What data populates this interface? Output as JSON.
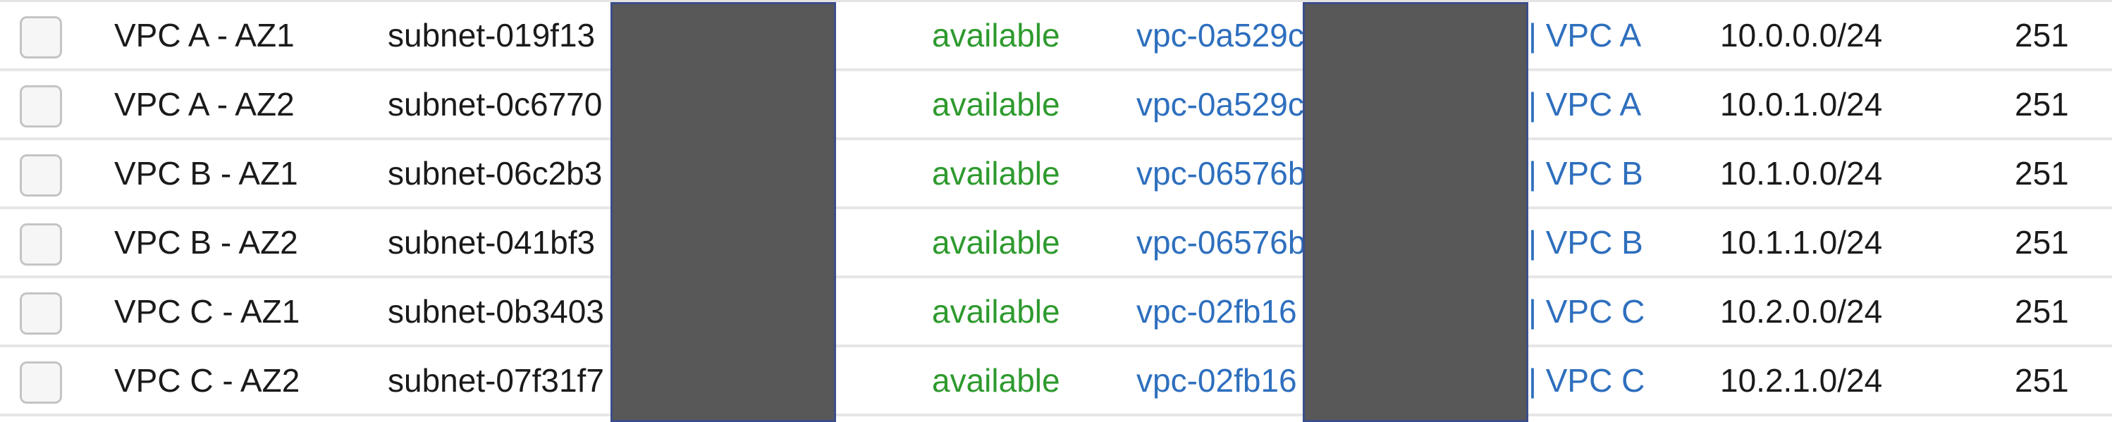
{
  "subnets_table": {
    "rows": [
      {
        "name": "VPC A - AZ1",
        "subnet_id": "subnet-019f13",
        "state": "available",
        "vpc_id": "vpc-0a529c",
        "vpc_name": "| VPC A",
        "cidr": "10.0.0.0/24",
        "available_ips": "251"
      },
      {
        "name": "VPC A - AZ2",
        "subnet_id": "subnet-0c6770",
        "state": "available",
        "vpc_id": "vpc-0a529c",
        "vpc_name": "| VPC A",
        "cidr": "10.0.1.0/24",
        "available_ips": "251"
      },
      {
        "name": "VPC B - AZ1",
        "subnet_id": "subnet-06c2b3",
        "state": "available",
        "vpc_id": "vpc-06576b",
        "vpc_name": "| VPC B",
        "cidr": "10.1.0.0/24",
        "available_ips": "251"
      },
      {
        "name": "VPC B - AZ2",
        "subnet_id": "subnet-041bf3",
        "state": "available",
        "vpc_id": "vpc-06576b",
        "vpc_name": "| VPC B",
        "cidr": "10.1.1.0/24",
        "available_ips": "251"
      },
      {
        "name": "VPC C - AZ1",
        "subnet_id": "subnet-0b3403",
        "state": "available",
        "vpc_id": "vpc-02fb16",
        "vpc_name": "| VPC C",
        "cidr": "10.2.0.0/24",
        "available_ips": "251"
      },
      {
        "name": "VPC C - AZ2",
        "subnet_id": "subnet-07f31f7",
        "state": "available",
        "vpc_id": "vpc-02fb16",
        "vpc_name": "| VPC C",
        "cidr": "10.2.1.0/24",
        "available_ips": "251"
      }
    ]
  },
  "colors": {
    "state_available": "#2e9a2e",
    "link": "#2e6fbe",
    "redaction": "#585858"
  }
}
